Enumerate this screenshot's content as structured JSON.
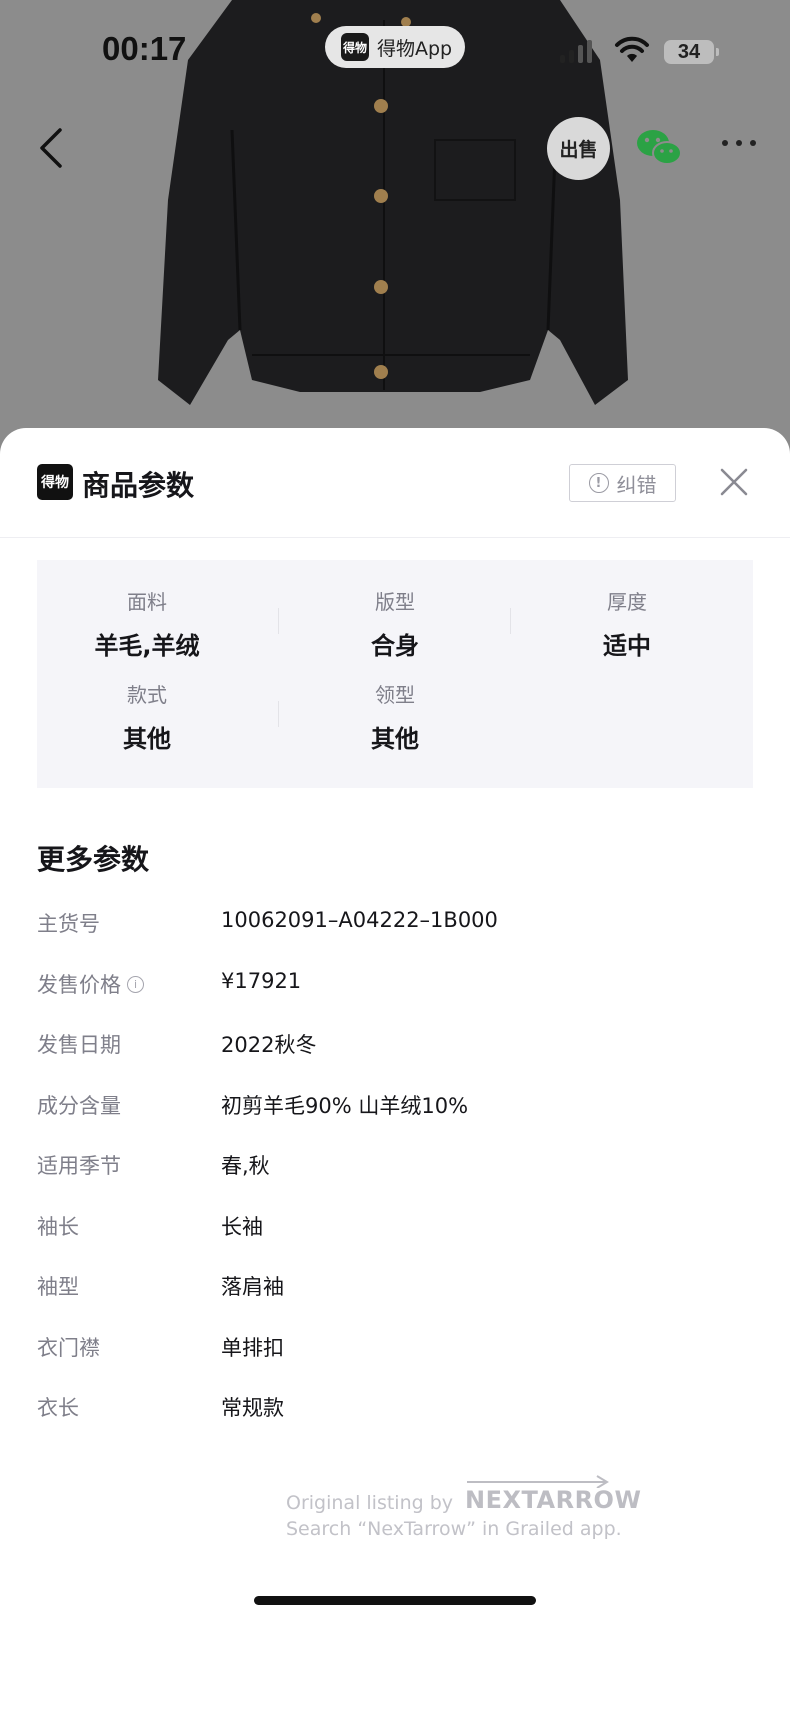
{
  "status_bar": {
    "time": "00:17",
    "app_pill_label": "得物App",
    "app_pill_logo": "得物",
    "battery": "34"
  },
  "nav": {
    "sell_label": "出售"
  },
  "sheet": {
    "logo_text": "得物",
    "title": "商品参数",
    "report_label": "纠错",
    "key_params": [
      {
        "label": "面料",
        "value": "羊毛,羊绒"
      },
      {
        "label": "版型",
        "value": "合身"
      },
      {
        "label": "厚度",
        "value": "适中"
      },
      {
        "label": "款式",
        "value": "其他"
      },
      {
        "label": "领型",
        "value": "其他"
      }
    ],
    "more_title": "更多参数",
    "details": [
      {
        "label": "主货号",
        "value": "10062091–A04222–1B000"
      },
      {
        "label": "发售价格",
        "value": "¥17921"
      },
      {
        "label": "发售日期",
        "value": "2022秋冬"
      },
      {
        "label": "成分含量",
        "value": "初剪羊毛90% 山羊绒10%"
      },
      {
        "label": "适用季节",
        "value": "春,秋"
      },
      {
        "label": "袖长",
        "value": "长袖"
      },
      {
        "label": "袖型",
        "value": "落肩袖"
      },
      {
        "label": "衣门襟",
        "value": "单排扣"
      },
      {
        "label": "衣长",
        "value": "常规款"
      }
    ]
  },
  "watermark": {
    "line1": "Original listing by",
    "brand": "NEXTARROW",
    "line2": "Search “NexTarrow” in Grailed app."
  }
}
